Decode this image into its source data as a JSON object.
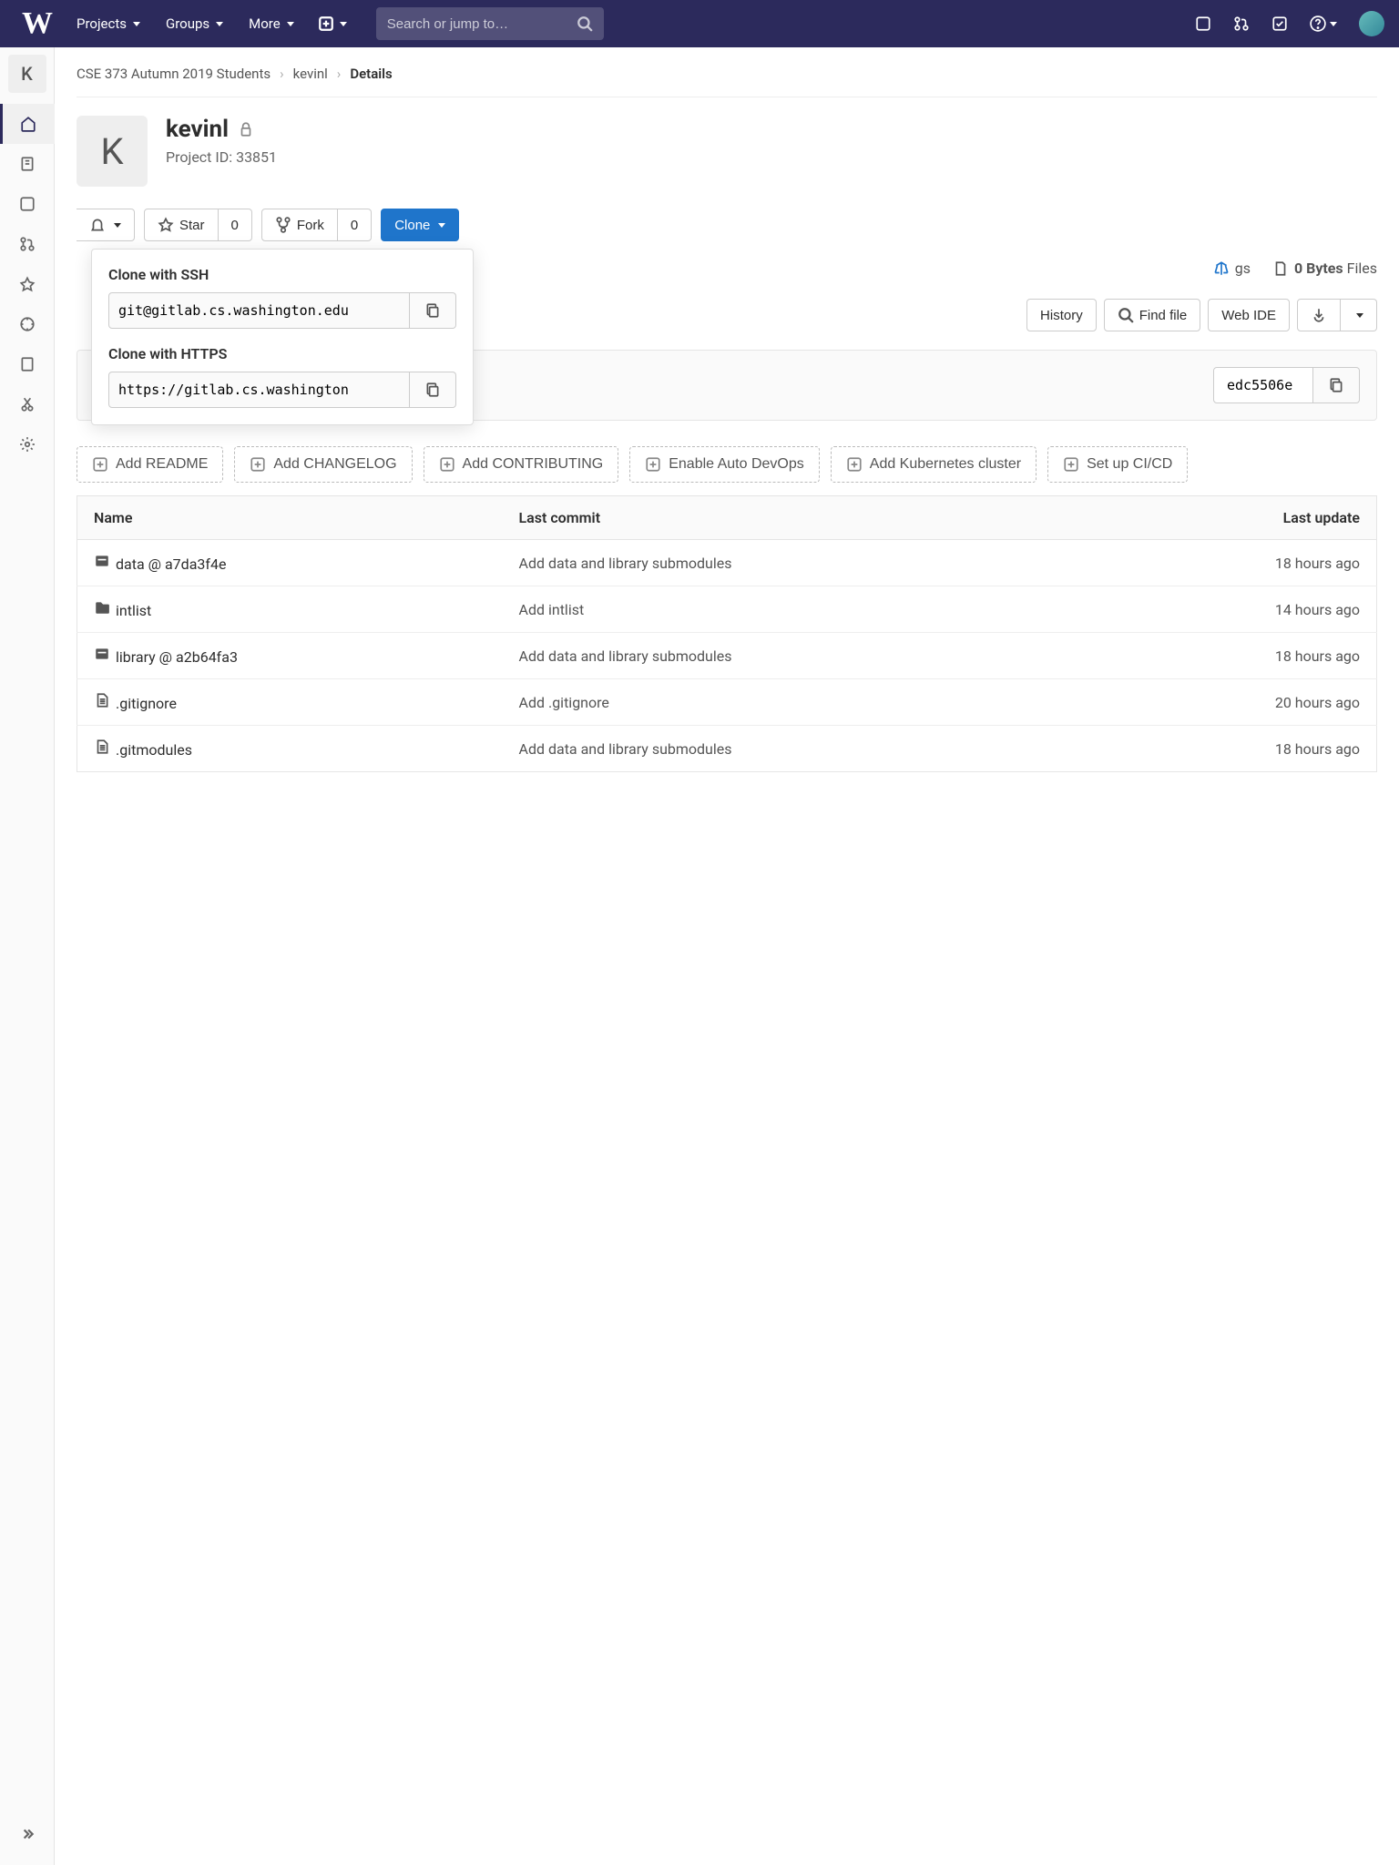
{
  "topbar": {
    "nav": [
      "Projects",
      "Groups",
      "More"
    ],
    "search_placeholder": "Search or jump to…"
  },
  "breadcrumb": {
    "root": "CSE 373 Autumn 2019 Students",
    "project": "kevinl",
    "current": "Details"
  },
  "project": {
    "avatar_letter": "K",
    "name": "kevinl",
    "id_label": "Project ID: 33851"
  },
  "sidebar": {
    "letter": "K"
  },
  "actions": {
    "star": "Star",
    "star_count": "0",
    "fork": "Fork",
    "fork_count": "0",
    "clone": "Clone"
  },
  "clone": {
    "ssh_label": "Clone with SSH",
    "ssh_url": "git@gitlab.cs.washington.edu",
    "https_label": "Clone with HTTPS",
    "https_url": "https://gitlab.cs.washington"
  },
  "stats": {
    "tags_partial": "gs",
    "size": "0 Bytes",
    "size_label": "Files"
  },
  "toolbar": {
    "history": "History",
    "find": "Find file",
    "webide": "Web IDE"
  },
  "commit": {
    "sha": "edc5506e"
  },
  "suggestions": [
    "Add README",
    "Add CHANGELOG",
    "Add CONTRIBUTING",
    "Enable Auto DevOps",
    "Add Kubernetes cluster",
    "Set up CI/CD"
  ],
  "files": {
    "headers": [
      "Name",
      "Last commit",
      "Last update"
    ],
    "rows": [
      {
        "icon": "submodule",
        "name": "data @ a7da3f4e",
        "commit": "Add data and library submodules",
        "updated": "18 hours ago"
      },
      {
        "icon": "folder",
        "name": "intlist",
        "commit": "Add intlist",
        "updated": "14 hours ago"
      },
      {
        "icon": "submodule",
        "name": "library @ a2b64fa3",
        "commit": "Add data and library submodules",
        "updated": "18 hours ago"
      },
      {
        "icon": "file",
        "name": ".gitignore",
        "commit": "Add .gitignore",
        "updated": "20 hours ago"
      },
      {
        "icon": "file",
        "name": ".gitmodules",
        "commit": "Add data and library submodules",
        "updated": "18 hours ago"
      }
    ]
  }
}
